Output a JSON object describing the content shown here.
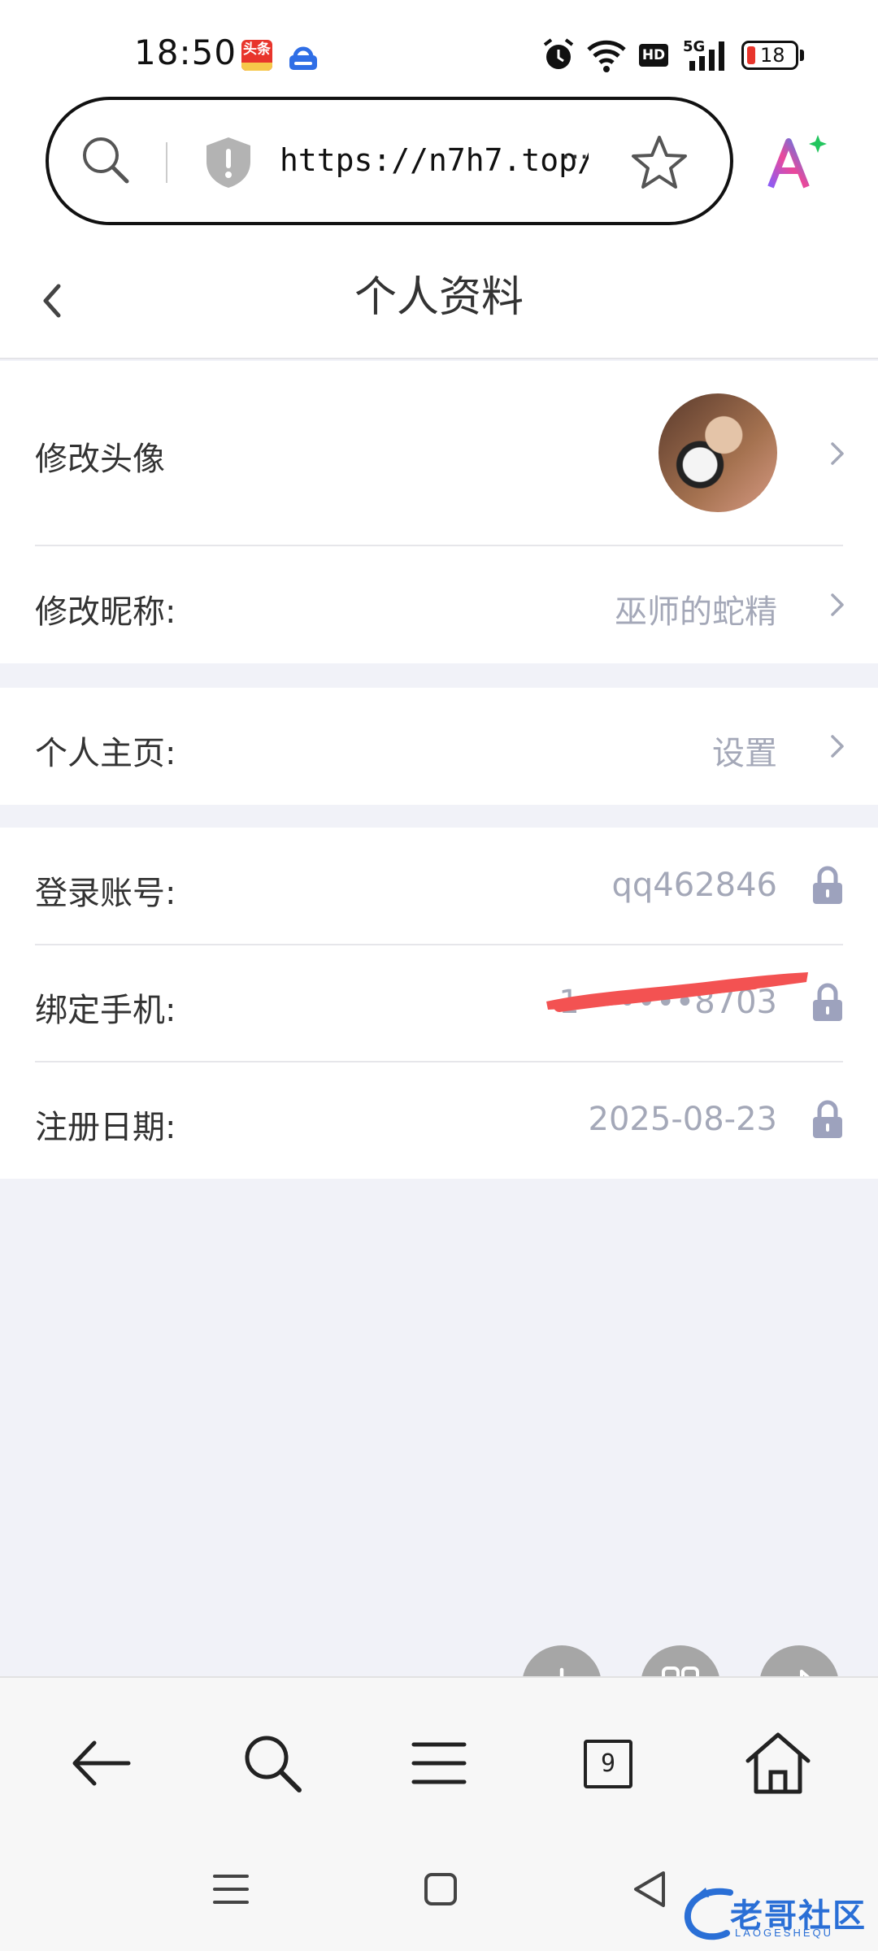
{
  "status_bar": {
    "time": "18:50",
    "toutiao_badge": "头条",
    "network": "5G",
    "hd": "HD",
    "battery": "18"
  },
  "browser": {
    "url": "https://n7h7.top/",
    "url_more": "···"
  },
  "header": {
    "title": "个人资料"
  },
  "profile": {
    "avatar_label": "修改头像",
    "nickname_label": "修改昵称:",
    "nickname_value": "巫师的蛇精",
    "homepage_label": "个人主页:",
    "homepage_value": "设置",
    "account_label": "登录账号:",
    "account_value": "qq462846",
    "phone_label": "绑定手机:",
    "phone_value": "1••••••8703",
    "register_label": "注册日期:",
    "register_value": "2025-08-23"
  },
  "toolbar": {
    "tab_count": "9"
  },
  "watermark": {
    "text": "老哥社区",
    "sub": "LAOGESHEQU"
  },
  "colors": {
    "page_background": "#f1f2f8",
    "value_text": "#a4a8b8",
    "redaction": "#f35252"
  }
}
